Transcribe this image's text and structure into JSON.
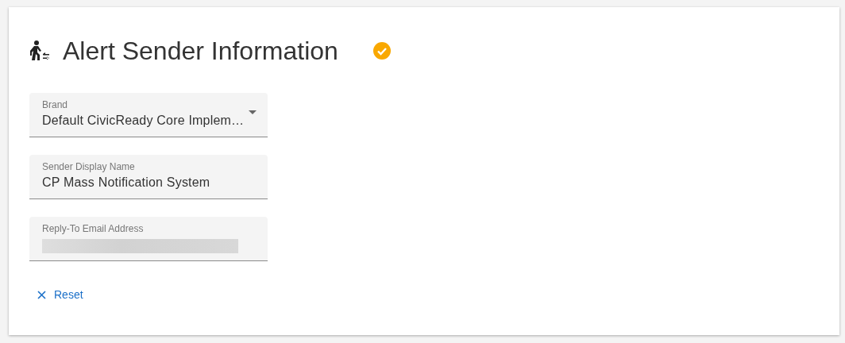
{
  "header": {
    "title": "Alert Sender Information",
    "complete": true
  },
  "fields": [
    {
      "kind": "select",
      "label": "Brand",
      "value": "Default CivicReady Core Implem…"
    },
    {
      "kind": "text",
      "label": "Sender Display Name",
      "value": "CP Mass Notification System"
    },
    {
      "kind": "redacted",
      "label": "Reply-To Email Address"
    }
  ],
  "reset_button": {
    "label": "Reset"
  }
}
